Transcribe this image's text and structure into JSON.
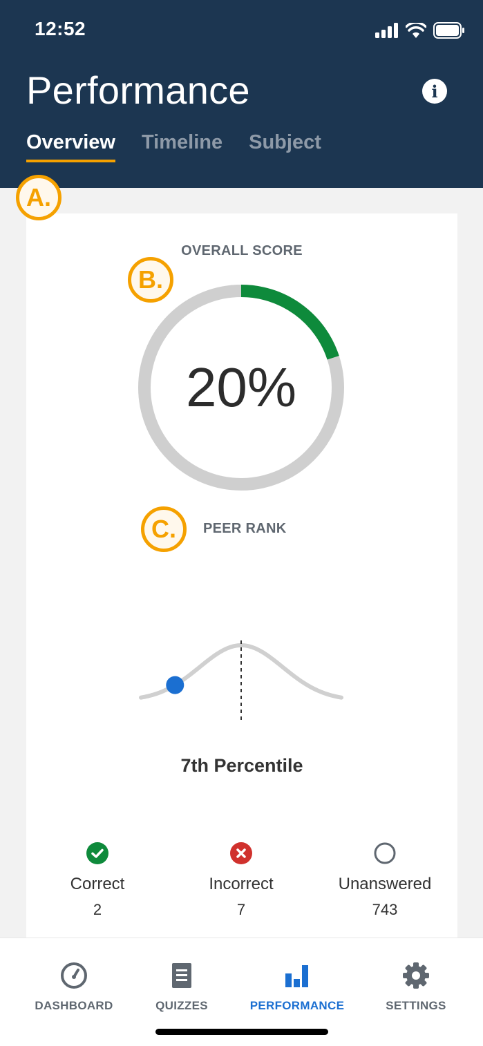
{
  "status_bar": {
    "time": "12:52"
  },
  "header": {
    "title": "Performance",
    "tabs": [
      {
        "label": "Overview",
        "active": true
      },
      {
        "label": "Timeline",
        "active": false
      },
      {
        "label": "Subject",
        "active": false
      }
    ]
  },
  "annotations": {
    "a": "A.",
    "b": "B.",
    "c": "C."
  },
  "overall_score": {
    "label": "OVERALL SCORE",
    "value": "20%",
    "fraction": 0.2,
    "color": "#0e8a3b"
  },
  "peer_rank": {
    "label": "PEER RANK",
    "percentile_text": "7th Percentile",
    "percentile": 7,
    "marker_color": "#1b6fd1"
  },
  "stats": [
    {
      "label": "Correct",
      "value": "2",
      "icon": "check-circle-icon",
      "color": "#0e8a3b"
    },
    {
      "label": "Incorrect",
      "value": "7",
      "icon": "x-circle-icon",
      "color": "#d0312d"
    },
    {
      "label": "Unanswered",
      "value": "743",
      "icon": "empty-circle-icon",
      "color": "#5f6770"
    }
  ],
  "bottom_nav": [
    {
      "label": "DASHBOARD",
      "icon": "gauge-icon",
      "active": false
    },
    {
      "label": "QUIZZES",
      "icon": "document-icon",
      "active": false
    },
    {
      "label": "PERFORMANCE",
      "icon": "bar-chart-icon",
      "active": true
    },
    {
      "label": "SETTINGS",
      "icon": "gear-icon",
      "active": false
    }
  ],
  "colors": {
    "header_bg": "#1c3651",
    "accent": "#f5a100",
    "active_nav": "#1b6fd1"
  }
}
